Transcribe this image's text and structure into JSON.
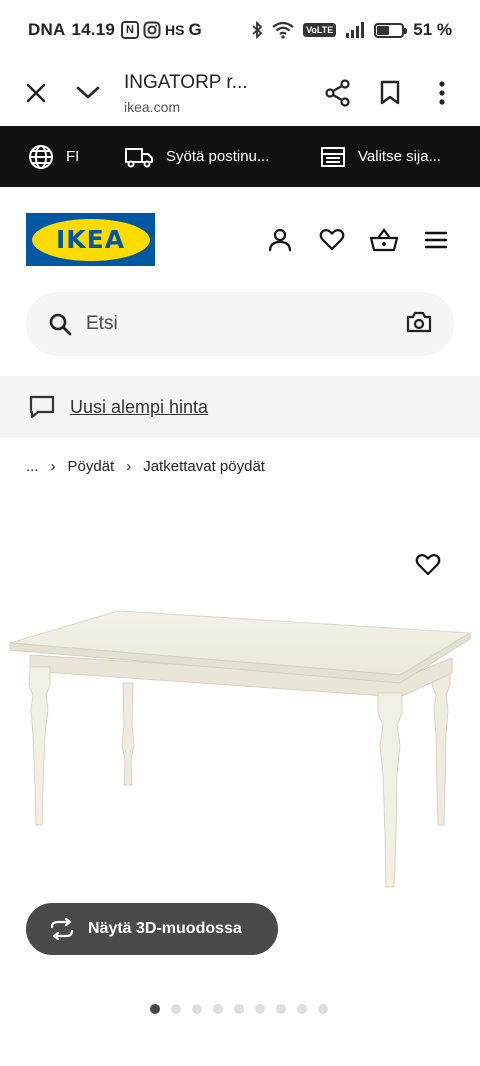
{
  "status_bar": {
    "carrier": "DNA",
    "time": "14.19",
    "app_icons": [
      "N",
      "HS",
      "G"
    ],
    "volte": "VoLTE",
    "battery": "51 %",
    "battery_level": 0.51
  },
  "browser": {
    "title": "INGATORP r...",
    "url": "ikea.com"
  },
  "top_strip": {
    "language": "FI",
    "postcode": "Syötä postinu...",
    "store": "Valitse sija..."
  },
  "header": {
    "logo_text": "IKEA",
    "brand_colors": {
      "blue": "#0058a3",
      "yellow": "#ffdb00"
    }
  },
  "search": {
    "placeholder": "Etsi"
  },
  "notice": {
    "text": "Uusi alempi hinta"
  },
  "breadcrumb": {
    "items": [
      "...",
      "Pöydät",
      "Jatkettavat pöydät"
    ]
  },
  "product": {
    "view_3d_label": "Näytä 3D-muodossa",
    "image_count": 9,
    "active_image": 1
  },
  "icons": {
    "browser": [
      "close-icon",
      "chevron-down-icon",
      "share-icon",
      "bookmark-icon",
      "more-vert-icon"
    ],
    "strip": [
      "globe-icon",
      "truck-icon",
      "store-icon"
    ],
    "header": [
      "user-icon",
      "heart-icon",
      "basket-icon",
      "menu-icon"
    ],
    "search": [
      "search-icon",
      "camera-icon"
    ],
    "notice": "chat-bubble-icon",
    "product": [
      "heart-icon",
      "rotate-3d-icon"
    ]
  }
}
